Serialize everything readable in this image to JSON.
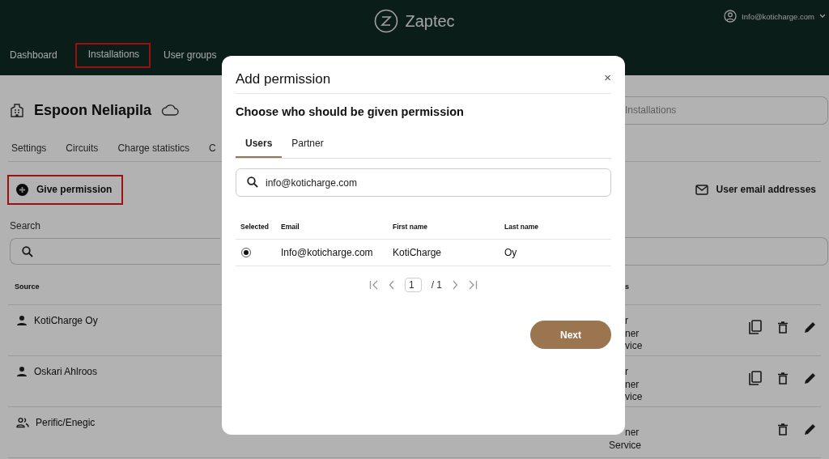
{
  "header": {
    "brand": "Zaptec",
    "account": "Info@koticharge.com"
  },
  "nav": [
    {
      "label": "Dashboard",
      "highlighted": false
    },
    {
      "label": "Installations",
      "highlighted": true
    },
    {
      "label": "User groups",
      "highlighted": false
    }
  ],
  "installation": {
    "title": "Espoon Neliapila",
    "search_placeholder": "Installations"
  },
  "tabs": [
    "Settings",
    "Circuits",
    "Charge statistics",
    "C"
  ],
  "give_permission": {
    "label": "Give permission",
    "highlighted": true
  },
  "email_button": "User email addresses",
  "search": {
    "label": "Search"
  },
  "permissions": {
    "columns": [
      "Source",
      "s"
    ],
    "rows": [
      {
        "source": "KotiCharge Oy",
        "kind": "user",
        "roles": [
          "r",
          "ner",
          "vice"
        ],
        "copy": true
      },
      {
        "source": "Oskari Ahlroos",
        "kind": "user",
        "roles": [
          "r",
          "ner",
          "vice"
        ],
        "copy": true
      },
      {
        "source": "Perific/Enegic",
        "kind": "group",
        "roles": [
          "ner",
          "Service"
        ],
        "copy": false
      }
    ]
  },
  "dialog": {
    "title": "Add permission",
    "close": "×",
    "heading": "Choose who should be given permission",
    "tabs": [
      {
        "label": "Users",
        "selected": true
      },
      {
        "label": "Partner",
        "selected": false
      }
    ],
    "search_value": "info@koticharge.com",
    "columns": [
      "Selected",
      "Email",
      "First name",
      "Last name"
    ],
    "rows": [
      {
        "selected": true,
        "email": "Info@koticharge.com",
        "first_name": "KotiCharge",
        "last_name": "Oy"
      }
    ],
    "pagination": {
      "page": "1",
      "total": "/ 1"
    },
    "next": "Next"
  }
}
